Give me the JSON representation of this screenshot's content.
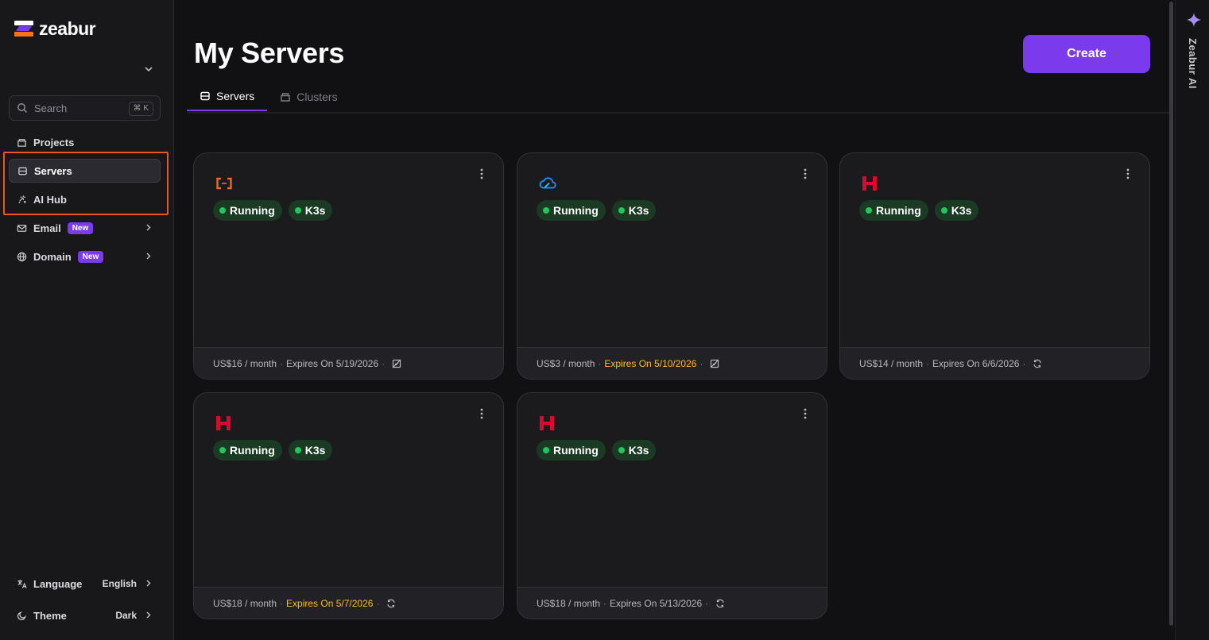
{
  "app": {
    "name": "zeabur"
  },
  "sidebar": {
    "search": {
      "placeholder": "Search",
      "shortcut": "⌘ K"
    },
    "items": [
      {
        "label": "Projects",
        "icon": "folder-icon"
      },
      {
        "label": "Servers",
        "icon": "server-icon",
        "active": true
      },
      {
        "label": "AI Hub",
        "icon": "sparkle-icon"
      },
      {
        "label": "Email",
        "icon": "mail-icon",
        "badge": "New"
      },
      {
        "label": "Domain",
        "icon": "globe-icon",
        "badge": "New"
      }
    ],
    "language": {
      "label": "Language",
      "value": "English"
    },
    "theme": {
      "label": "Theme",
      "value": "Dark"
    }
  },
  "main": {
    "title": "My Servers",
    "create_label": "Create",
    "tabs": [
      {
        "label": "Servers",
        "active": true
      },
      {
        "label": "Clusters",
        "active": false
      }
    ],
    "servers": [
      {
        "provider": "alibaba-cloud-icon",
        "status": "Running",
        "tag": "K3s",
        "price": "US$16 / month",
        "expires": "Expires On 5/19/2026",
        "expires_warn": false,
        "renew_icon": "auto-renew-off-icon"
      },
      {
        "provider": "tencent-cloud-icon",
        "status": "Running",
        "tag": "K3s",
        "price": "US$3 / month",
        "expires": "Expires On 5/10/2026",
        "expires_warn": true,
        "renew_icon": "auto-renew-off-icon"
      },
      {
        "provider": "hetzner-icon",
        "status": "Running",
        "tag": "K3s",
        "price": "US$14 / month",
        "expires": "Expires On 6/6/2026",
        "expires_warn": false,
        "renew_icon": "auto-renew-icon"
      },
      {
        "provider": "hetzner-icon",
        "status": "Running",
        "tag": "K3s",
        "price": "US$18 / month",
        "expires": "Expires On 5/7/2026",
        "expires_warn": true,
        "renew_icon": "auto-renew-icon"
      },
      {
        "provider": "hetzner-icon",
        "status": "Running",
        "tag": "K3s",
        "price": "US$18 / month",
        "expires": "Expires On 5/13/2026",
        "expires_warn": false,
        "renew_icon": "auto-renew-icon"
      }
    ]
  },
  "ai_panel": {
    "label": "Zeabur AI"
  },
  "colors": {
    "accent": "#7c3aed",
    "running": "#22c55e",
    "warning": "#fbbf24",
    "highlight": "#e8581e"
  }
}
